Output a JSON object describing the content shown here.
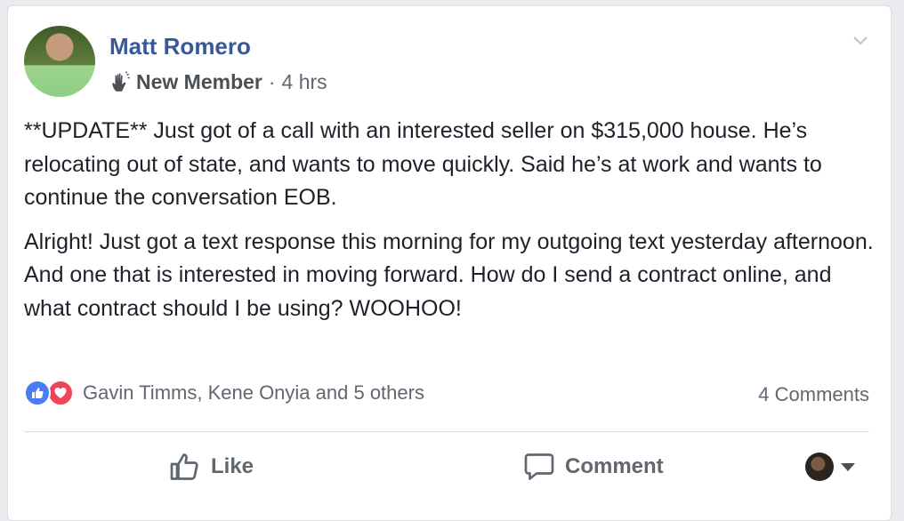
{
  "post": {
    "author": "Matt Romero",
    "badge": "New Member",
    "separator": "·",
    "time": "4 hrs",
    "paragraphs": [
      "**UPDATE** Just got of a call with an interested seller on $315,000 house. He’s relocating out of state, and wants to move quickly. Said he’s at work and wants to continue the conversation EOB.",
      "Alright! Just got a text response this morning for my outgoing text yesterday afternoon. And one that is interested in moving forward. How do I send a contract online, and what contract should I be using? WOOHOO!"
    ]
  },
  "reactions": {
    "names": "Gavin Timms, Kene Onyia and 5 others",
    "comments": "4 Comments",
    "icons": [
      "like-reaction-icon",
      "love-reaction-icon"
    ],
    "colors": {
      "like": "#4a7cf6",
      "love": "#f0445a"
    }
  },
  "actions": {
    "like_label": "Like",
    "comment_label": "Comment"
  },
  "colors": {
    "author": "#385898",
    "text": "#1d2129",
    "muted": "#606770"
  }
}
